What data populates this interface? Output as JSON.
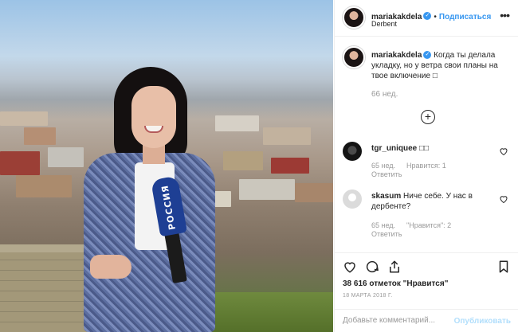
{
  "post": {
    "author": "mariakakdela",
    "follow_label": "Подписаться",
    "separator": "•",
    "location": "Derbent",
    "more_label": "•••",
    "mic_text": "РОССИЯ"
  },
  "caption": {
    "username": "mariakakdela",
    "text": "Когда ты делала укладку, но у ветра свои планы на твое включение □",
    "time": "66 нед."
  },
  "load_more_label": "+",
  "comments": [
    {
      "username": "tgr_uniquee",
      "text": "□□",
      "time": "65 нед.",
      "likes": "Нравится: 1",
      "reply": "Ответить"
    },
    {
      "username": "skasum",
      "text": "Ниче себе. У нас в дербенте?",
      "time": "65 нед.",
      "likes": "\"Нравится\": 2",
      "reply": "Ответить"
    }
  ],
  "stats": {
    "likes": "38 616 отметок \"Нравится\"",
    "date": "18 МАРТА 2018 Г."
  },
  "comment_box": {
    "placeholder": "Добавьте комментарий...",
    "publish_label": "Опубликовать"
  },
  "colors": {
    "accent": "#3897f0",
    "publish_disabled": "#b2dffc",
    "muted": "#999999"
  },
  "icons": [
    "verified-icon",
    "more-icon",
    "load-more-icon",
    "heart-icon",
    "comment-icon",
    "share-icon",
    "bookmark-icon"
  ]
}
